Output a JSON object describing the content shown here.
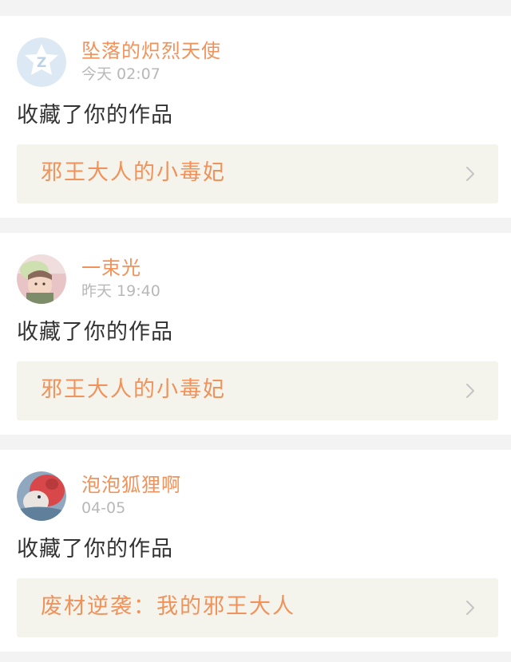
{
  "notifications": [
    {
      "user": "坠落的炽烈天使",
      "time": "今天 02:07",
      "action": "收藏了你的作品",
      "work_title": "邪王大人的小毒妃",
      "avatar": "default-avatar-z"
    },
    {
      "user": "一束光",
      "time": "昨天 19:40",
      "action": "收藏了你的作品",
      "work_title": "邪王大人的小毒妃",
      "avatar": "user-photo-avatar"
    },
    {
      "user": "泡泡狐狸啊",
      "time": "04-05",
      "action": "收藏了你的作品",
      "work_title": "废材逆袭：我的邪王大人",
      "avatar": "fox-photo-avatar"
    }
  ],
  "colors": {
    "accent": "#f0925a",
    "background": "#f3f3f3",
    "card": "#ffffff",
    "link_bg": "#f4f3ec",
    "action_text": "#333333",
    "time_text": "#b8b8b8"
  }
}
